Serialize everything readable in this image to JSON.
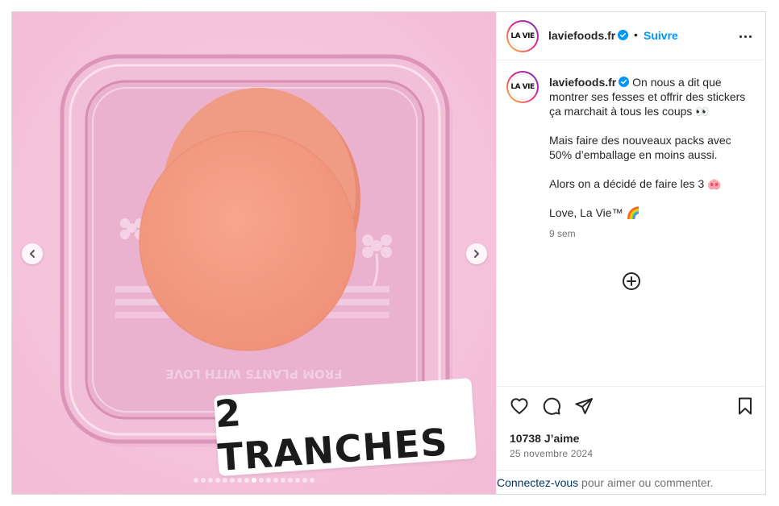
{
  "account": {
    "username": "laviefoods.fr",
    "logo_text": "LA VIE",
    "follow_label": "Suivre",
    "separator": "•"
  },
  "media": {
    "sticker_text": "2 TRANCHES",
    "embossed_text": "FROM PLANTS WITH LOVE",
    "slide_count": 17,
    "active_slide": 8
  },
  "caption": {
    "username": "laviefoods.fr",
    "paragraphs": [
      "On nous a dit que montrer ses fesses et offrir des stickers ça marchait à tous les coups 👀",
      "Mais faire des nouveaux packs avec 50% d’emballage en moins aussi.",
      "Alors on a décidé de faire les 3 🐽",
      "Love, La Vie™ 🌈"
    ],
    "time_ago": "9 sem"
  },
  "engagement": {
    "likes": "10738 J’aime",
    "date": "25 novembre 2024"
  },
  "footer": {
    "login_link": "Connectez-vous",
    "login_text": " pour aimer ou commenter."
  },
  "colors": {
    "background_pink": "#f6c6dc",
    "link_blue": "#0095f6",
    "verified_blue": "#0095f6",
    "login_link": "#00376b"
  },
  "icons": [
    "chevron-left-icon",
    "chevron-right-icon",
    "verified-icon",
    "more-icon",
    "add-comment-icon",
    "heart-icon",
    "comment-icon",
    "share-icon",
    "bookmark-icon"
  ]
}
